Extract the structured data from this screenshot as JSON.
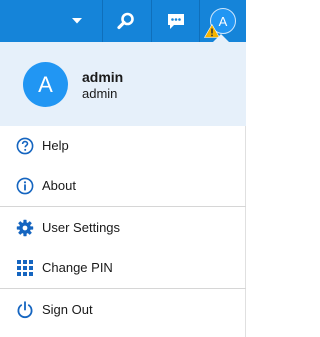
{
  "header": {
    "avatar_letter": "A",
    "colors": {
      "bar": "#1584d9",
      "accent": "#2196f3",
      "warning": "#f5b400"
    },
    "icons": [
      "caret-down-icon",
      "search-icon",
      "chat-icon",
      "warning-icon"
    ]
  },
  "user": {
    "avatar_letter": "A",
    "name": "admin",
    "role": "admin"
  },
  "menu": {
    "items": [
      {
        "label": "Help",
        "icon": "help-circle-icon"
      },
      {
        "label": "About",
        "icon": "info-circle-icon"
      },
      {
        "label": "User Settings",
        "icon": "gear-icon"
      },
      {
        "label": "Change PIN",
        "icon": "keypad-icon"
      },
      {
        "label": "Sign Out",
        "icon": "power-icon"
      }
    ]
  }
}
